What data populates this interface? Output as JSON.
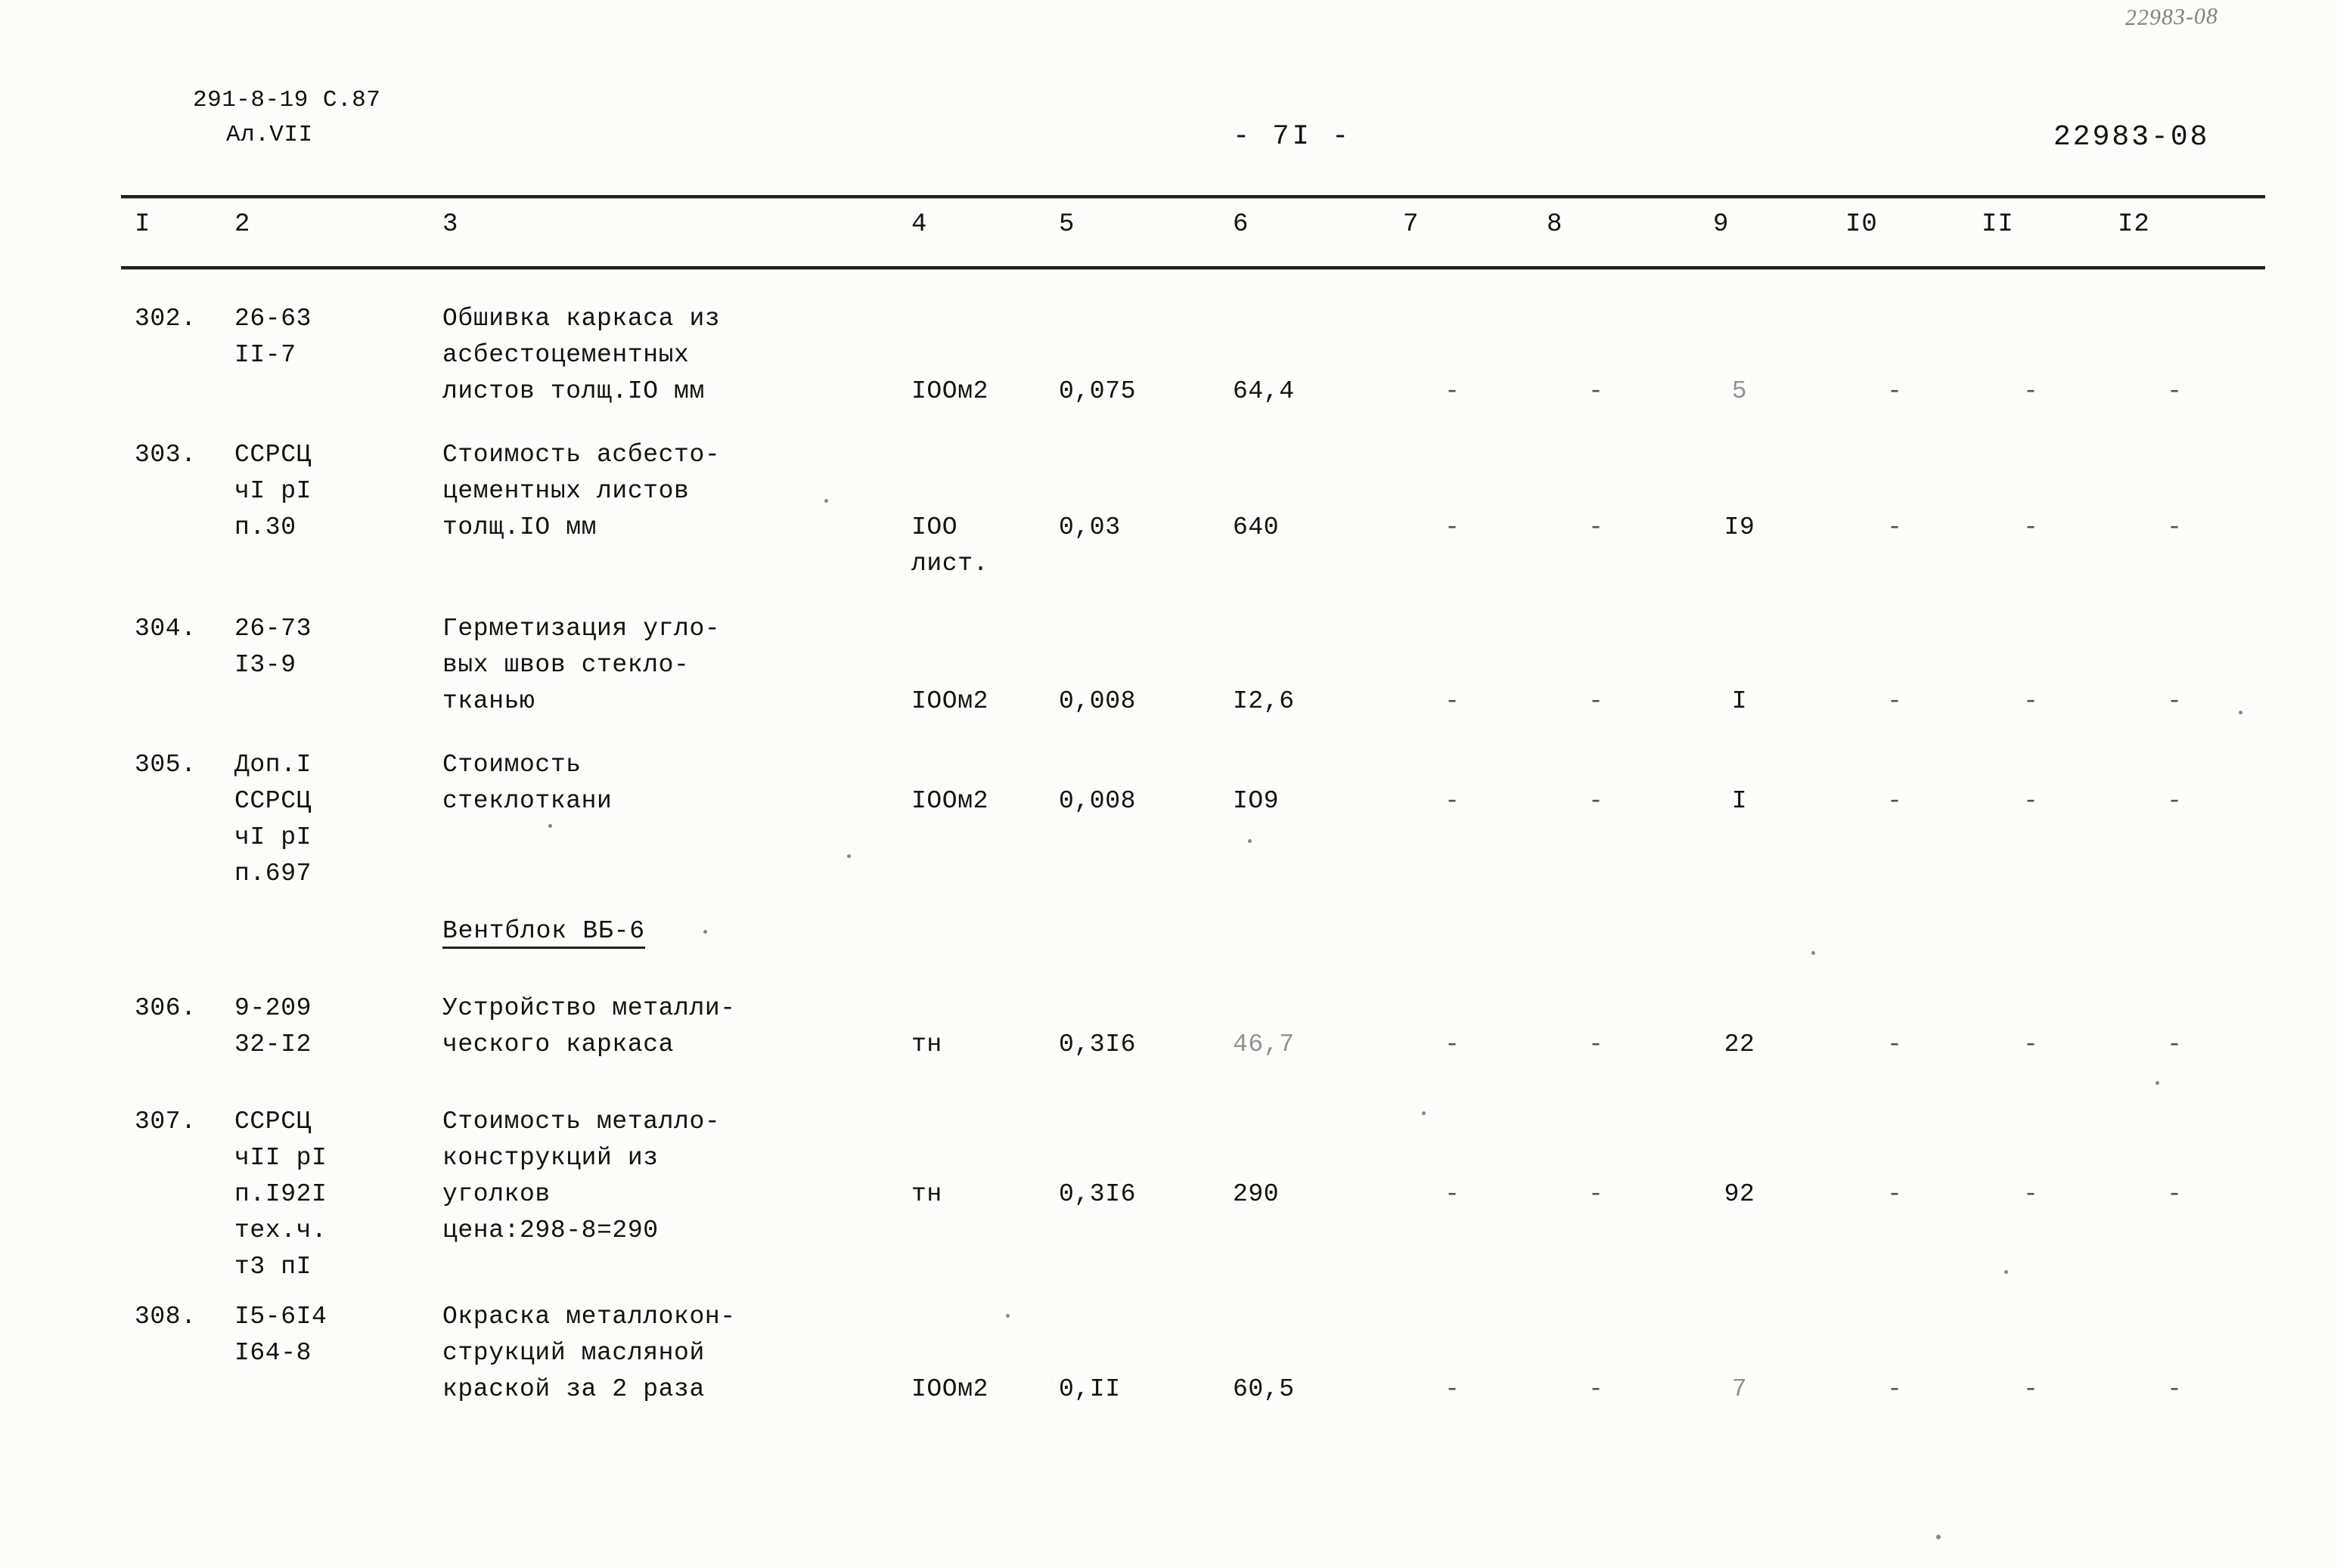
{
  "document": {
    "top_right_stamp": "22983-08",
    "header_left_line1": "291-8-19 С.87",
    "header_left_line2": "Ал.VII",
    "page_number": "- 7I -",
    "header_right": "22983-08"
  },
  "table": {
    "column_headers": [
      "I",
      "2",
      "3",
      "4",
      "5",
      "6",
      "7",
      "8",
      "9",
      "I0",
      "II",
      "I2"
    ],
    "rows": [
      {
        "num": "302.",
        "code": "26-63\nII-7",
        "desc": "Обшивка каркаса из\nасбестоцементных\nлистов толщ.IO мм",
        "unit": "IOOм2",
        "c5": "0,075",
        "c6": "64,4",
        "c7": "-",
        "c8": "-",
        "c9": "5",
        "c10": "-",
        "c11": "-",
        "c12": "-"
      },
      {
        "num": "303.",
        "code": "ССРСЦ\nчI pI\nп.30",
        "desc": "Стоимость асбесто-\nцементных листов\nтолщ.IO мм",
        "unit": "IOO\nлист.",
        "c5": "0,03",
        "c6": "640",
        "c7": "-",
        "c8": "-",
        "c9": "I9",
        "c10": "-",
        "c11": "-",
        "c12": "-"
      },
      {
        "num": "304.",
        "code": "26-73\nI3-9",
        "desc": "Герметизация угло-\nвых швов стекло-\nтканью",
        "unit": "IOOм2",
        "c5": "0,008",
        "c6": "I2,6",
        "c7": "-",
        "c8": "-",
        "c9": "I",
        "c10": "-",
        "c11": "-",
        "c12": "-"
      },
      {
        "num": "305.",
        "code": "Доп.I\nССРСЦ\nчI pI\nп.697",
        "desc": "Стоимость\nстеклоткани",
        "unit": "IOOм2",
        "c5": "0,008",
        "c6": "IO9",
        "c7": "-",
        "c8": "-",
        "c9": "I",
        "c10": "-",
        "c11": "-",
        "c12": "-"
      },
      {
        "num": "306.",
        "code": "9-209\n32-I2",
        "desc": "Устройство металли-\nческого каркаса",
        "unit": "тн",
        "c5": "0,3I6",
        "c6": "46,7",
        "c7": "-",
        "c8": "-",
        "c9": "22",
        "c10": "-",
        "c11": "-",
        "c12": "-"
      },
      {
        "num": "307.",
        "code": "ССРСЦ\nчII pI\nп.I92I\nтех.ч.\nт3 пI",
        "desc": "Стоимость металло-\nконструкций из\nуголков\nцена:298-8=290",
        "unit": "тн",
        "c5": "0,3I6",
        "c6": "290",
        "c7": "-",
        "c8": "-",
        "c9": "92",
        "c10": "-",
        "c11": "-",
        "c12": "-"
      },
      {
        "num": "308.",
        "code": "I5-6I4\nI64-8",
        "desc": "Окраска металлокон-\nструкций масляной\nкраской за 2 раза",
        "unit": "IOOм2",
        "c5": "0,II",
        "c6": "60,5",
        "c7": "-",
        "c8": "-",
        "c9": "7",
        "c10": "-",
        "c11": "-",
        "c12": "-"
      }
    ],
    "section_heading": "Вентблок ВБ-6"
  }
}
